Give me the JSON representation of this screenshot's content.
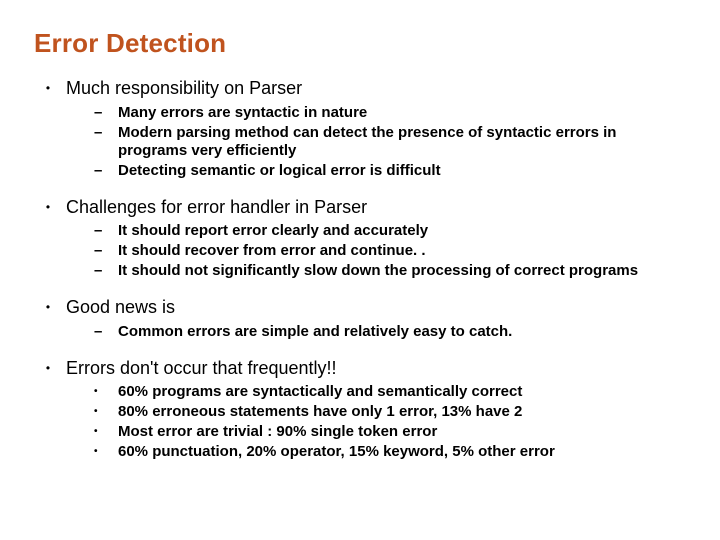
{
  "title": "Error Detection",
  "sections": [
    {
      "heading": "Much responsibility on Parser",
      "marker": "dash",
      "items": [
        "Many errors are syntactic in nature",
        "Modern parsing method can detect the presence of syntactic errors in programs very efficiently",
        "Detecting semantic or logical error is difficult"
      ]
    },
    {
      "heading": "Challenges for error handler in Parser",
      "marker": "dash",
      "items": [
        "It should report error clearly and accurately",
        "It should recover from error and continue. .",
        "It should not significantly slow down the processing of correct programs"
      ]
    },
    {
      "heading": "Good news is",
      "marker": "dash",
      "items": [
        "Common errors are simple and relatively easy to catch."
      ]
    },
    {
      "heading": "Errors don't occur that frequently!!",
      "marker": "dot",
      "items": [
        "60% programs are syntactically and semantically correct",
        "80% erroneous statements have only 1 error, 13% have 2",
        "Most error are trivial : 90% single token error",
        "60% punctuation, 20% operator, 15% keyword, 5% other error"
      ]
    }
  ]
}
